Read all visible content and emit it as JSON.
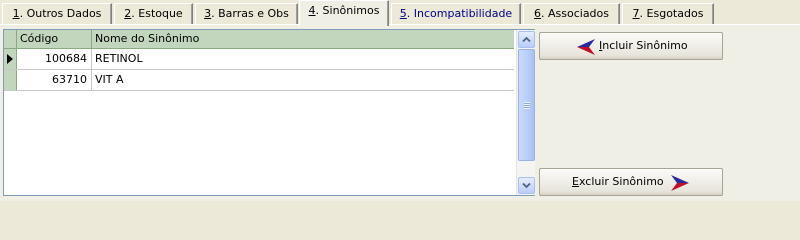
{
  "tabs": [
    {
      "accel": "1",
      "label": ". Outros Dados",
      "active": false,
      "blue": false
    },
    {
      "accel": "2",
      "label": ". Estoque",
      "active": false,
      "blue": false
    },
    {
      "accel": "3",
      "label": ". Barras e Obs",
      "active": false,
      "blue": false
    },
    {
      "accel": "4",
      "label": ". Sinônimos",
      "active": true,
      "blue": false
    },
    {
      "accel": "5",
      "label": ". Incompatibilidade",
      "active": false,
      "blue": true
    },
    {
      "accel": "6",
      "label": ". Associados",
      "active": false,
      "blue": false
    },
    {
      "accel": "7",
      "label": ". Esgotados",
      "active": false,
      "blue": false
    }
  ],
  "grid": {
    "columns": [
      "Código",
      "Nome do Sinônimo"
    ],
    "rows": [
      {
        "code": "100684",
        "name": "RETINOL",
        "current": true
      },
      {
        "code": "63710",
        "name": "VIT A",
        "current": false
      }
    ]
  },
  "buttons": {
    "incluir": {
      "accel": "I",
      "rest": "ncluir Sinônimo"
    },
    "excluir": {
      "accel": "E",
      "rest": "xcluir Sinônimo"
    }
  },
  "colors": {
    "header": "#c2d6be",
    "arrow_red": "#c0102b",
    "arrow_blue": "#2a2aa0"
  }
}
